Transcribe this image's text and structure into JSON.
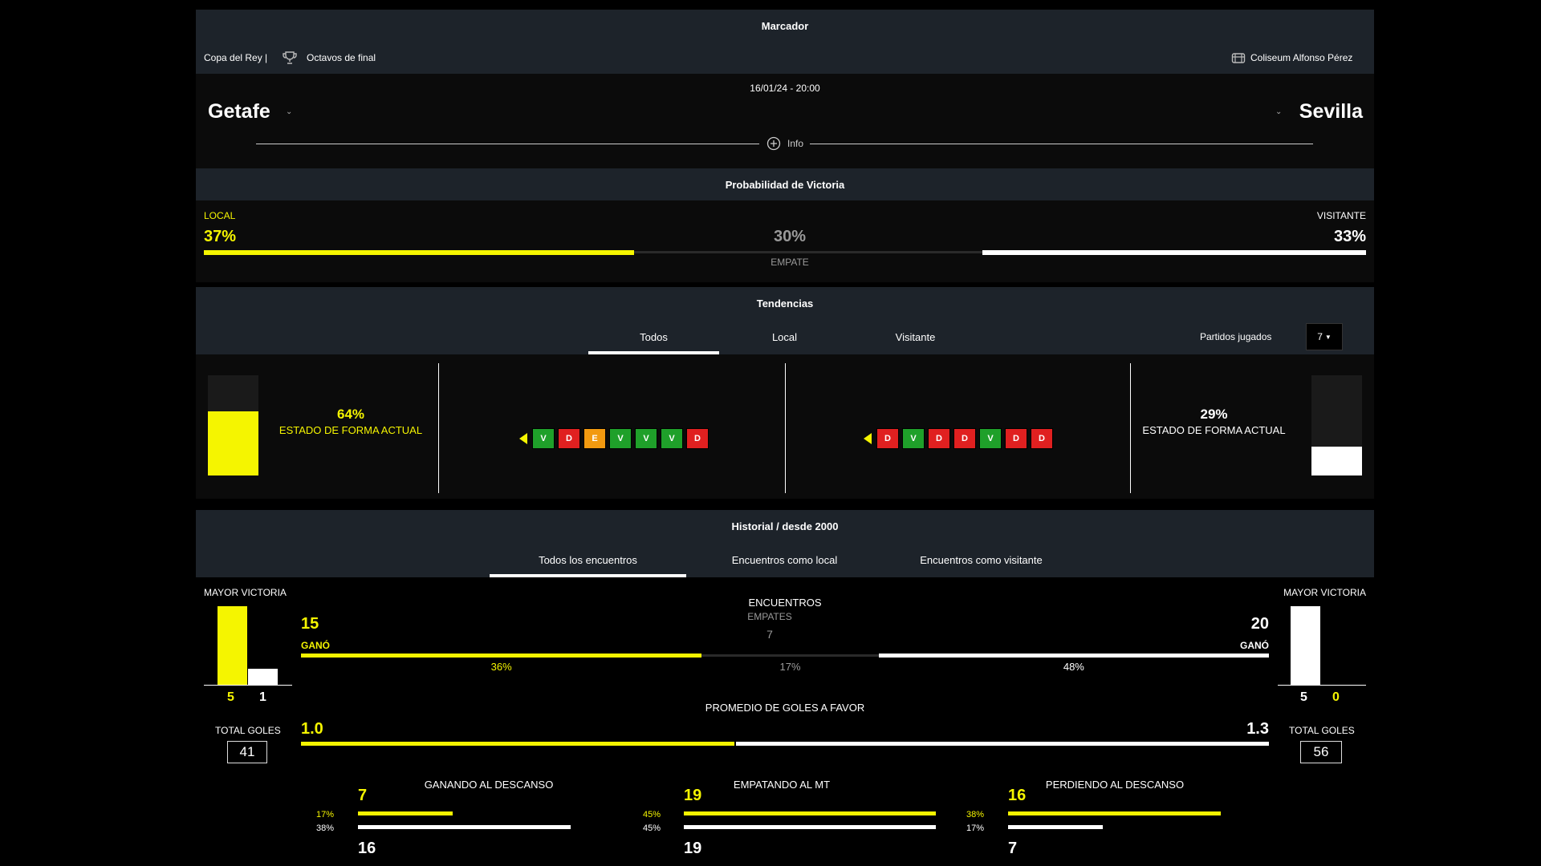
{
  "scoreboard": {
    "title": "Marcador",
    "competition": "Copa del Rey |",
    "round": "Octavos de final",
    "stadium": "Coliseum Alfonso Pérez",
    "datetime": "16/01/24 - 20:00",
    "home_team": "Getafe",
    "away_team": "Sevilla",
    "info_label": "Info"
  },
  "probability": {
    "title": "Probabilidad de Victoria",
    "home_label": "LOCAL",
    "home_pct": "37%",
    "draw_pct": "30%",
    "draw_label": "EMPATE",
    "away_label": "VISITANTE",
    "away_pct": "33%",
    "home_value": 37,
    "draw_value": 30,
    "away_value": 33
  },
  "trends": {
    "title": "Tendencias",
    "tabs": [
      "Todos",
      "Local",
      "Visitante"
    ],
    "active_tab": 0,
    "played_label": "Partidos jugados",
    "played_value": "7",
    "home_form_pct": "64%",
    "home_form_value": 64,
    "home_form_label": "ESTADO DE FORMA ACTUAL",
    "away_form_pct": "29%",
    "away_form_value": 29,
    "away_form_label": "ESTADO DE FORMA ACTUAL",
    "home_results": [
      "V",
      "D",
      "E",
      "V",
      "V",
      "V",
      "D"
    ],
    "away_results": [
      "D",
      "V",
      "D",
      "D",
      "V",
      "D",
      "D"
    ]
  },
  "history": {
    "title": "Historial / desde 2000",
    "tabs": [
      "Todos los encuentros",
      "Encuentros como local",
      "Encuentros como visitante"
    ],
    "active_tab": 0,
    "biggest_win_label": "MAYOR VICTORIA",
    "home_biggest": [
      "5",
      "1"
    ],
    "away_biggest": [
      "5",
      "0"
    ],
    "total_goals_label": "TOTAL GOLES",
    "home_total_goals": "41",
    "away_total_goals": "56",
    "encounters_label": "ENCUENTROS",
    "home_wins": "15",
    "won_label": "GANÓ",
    "draws_label": "EMPATES",
    "draws": "7",
    "away_wins": "20",
    "home_win_pct": "36%",
    "draw_pct": "17%",
    "away_win_pct": "48%",
    "home_win_value": 36,
    "draw_value": 17,
    "away_win_value": 48,
    "avg_goals_label": "PROMEDIO DE GOLES A FAVOR",
    "home_avg": "1.0",
    "away_avg": "1.3",
    "home_avg_value": 1.0,
    "away_avg_value": 1.3,
    "halftime": [
      {
        "label": "GANANDO AL DESCANSO",
        "home": "7",
        "away": "16",
        "home_pct": "17%",
        "away_pct": "38%",
        "home_value": 17,
        "away_value": 38
      },
      {
        "label": "EMPATANDO AL MT",
        "home": "19",
        "away": "19",
        "home_pct": "45%",
        "away_pct": "45%",
        "home_value": 45,
        "away_value": 45
      },
      {
        "label": "PERDIENDO AL DESCANSO",
        "home": "16",
        "away": "7",
        "home_pct": "38%",
        "away_pct": "17%",
        "home_value": 38,
        "away_value": 17
      }
    ]
  },
  "colors": {
    "home": "#f5f500",
    "away": "#ffffff",
    "win": "#1fa02a",
    "loss": "#e02020",
    "draw": "#f29a10",
    "header_bg": "#1d232a"
  }
}
